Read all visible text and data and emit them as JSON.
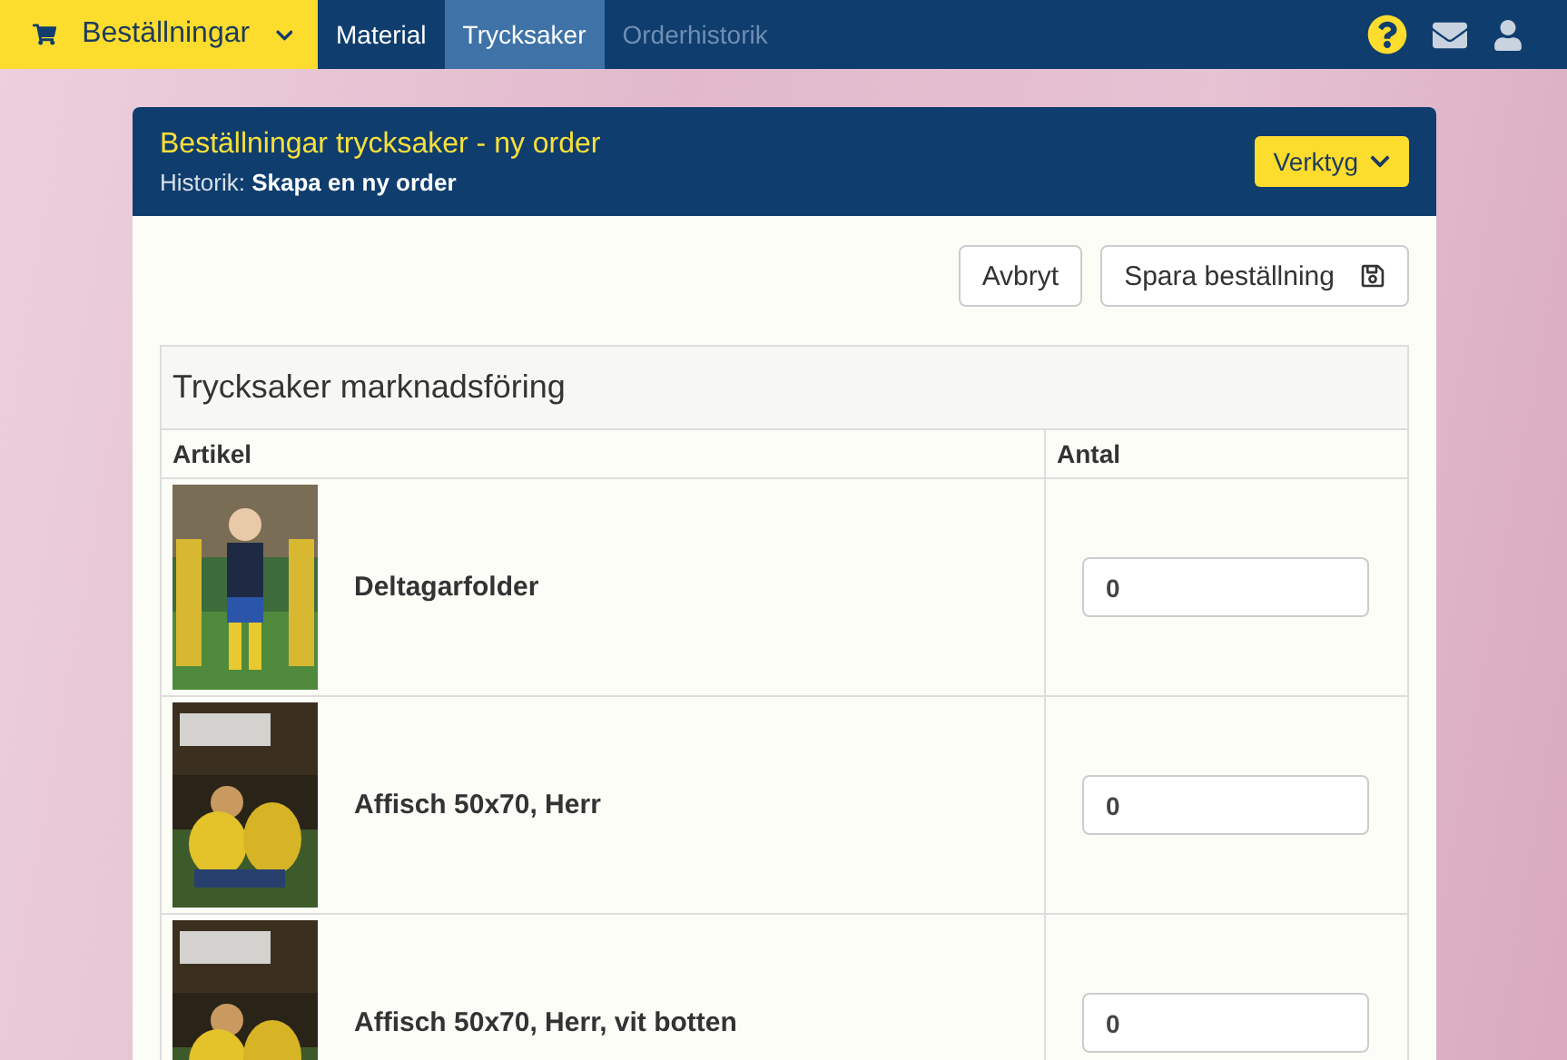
{
  "navbar": {
    "brand": "Beställningar",
    "tabs": [
      {
        "label": "Material",
        "selected": false,
        "disabled": false
      },
      {
        "label": "Trycksaker",
        "selected": true,
        "disabled": false
      },
      {
        "label": "Orderhistorik",
        "selected": false,
        "disabled": true
      }
    ]
  },
  "panel": {
    "title": "Beställningar trycksaker - ny order",
    "history_label": "Historik:",
    "history_value": "Skapa en ny order",
    "tools_button": "Verktyg"
  },
  "actions": [
    "Avbryt",
    "Spara beställning"
  ],
  "table": {
    "title": "Trycksaker marknadsföring",
    "columns": [
      "Artikel",
      "Antal"
    ],
    "rows": [
      {
        "name": "Deltagarfolder",
        "quantity": "0"
      },
      {
        "name": "Affisch 50x70, Herr",
        "quantity": "0"
      },
      {
        "name": "Affisch 50x70, Herr, vit botten",
        "quantity": "0"
      }
    ]
  }
}
